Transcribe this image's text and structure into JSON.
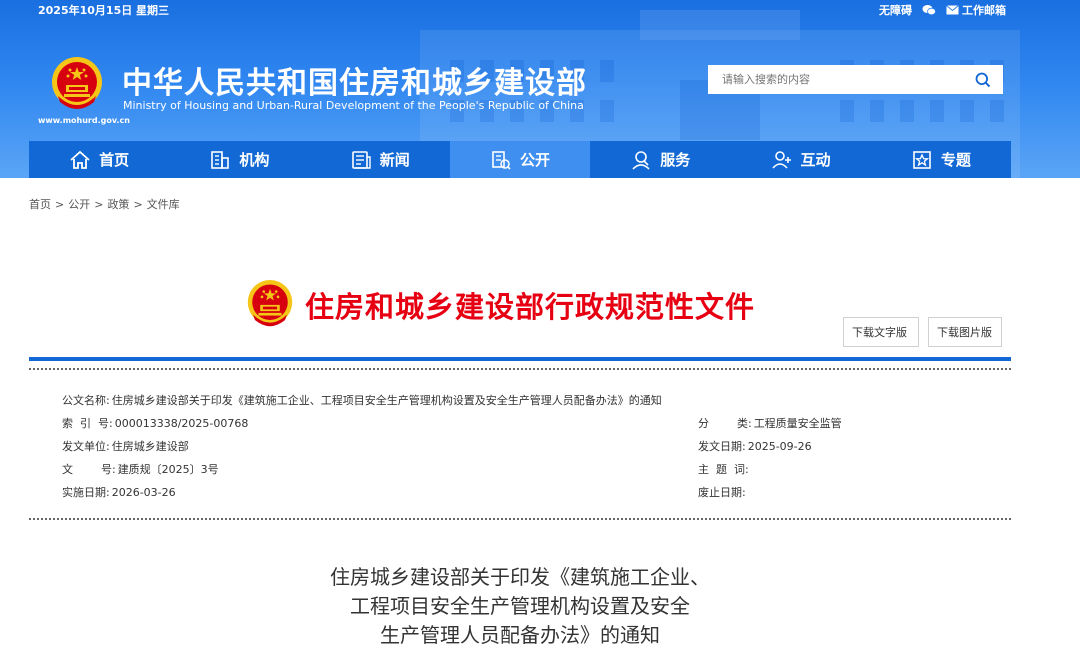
{
  "topbar": {
    "date": "2025年10月15日 星期三",
    "accessibility": "无障碍",
    "mail": "工作邮箱"
  },
  "site": {
    "url": "www.mohurd.gov.cn",
    "title": "中华人民共和国住房和城乡建设部",
    "subtitle": "Ministry of Housing and Urban-Rural Development of the People's Republic of China"
  },
  "search": {
    "placeholder": "请输入搜索的内容"
  },
  "nav": {
    "items": [
      {
        "label": "首页",
        "icon": "home-icon"
      },
      {
        "label": "机构",
        "icon": "building-icon"
      },
      {
        "label": "新闻",
        "icon": "news-icon"
      },
      {
        "label": "公开",
        "icon": "public-icon",
        "active": true
      },
      {
        "label": "服务",
        "icon": "service-icon"
      },
      {
        "label": "互动",
        "icon": "interact-icon"
      },
      {
        "label": "专题",
        "icon": "topic-icon"
      }
    ]
  },
  "breadcrumb": [
    "首页",
    "公开",
    "政策",
    "文件库"
  ],
  "doc_banner": {
    "title": "住房和城乡建设部行政规范性文件",
    "download_text": "下载文字版",
    "download_image": "下载图片版"
  },
  "meta": {
    "doc_name_label": "公文名称:",
    "doc_name": "住房城乡建设部关于印发《建筑施工企业、工程项目安全生产管理机构设置及安全生产管理人员配备办法》的通知",
    "index_label": "索  引  号:",
    "index": "000013338/2025-00768",
    "category_label": "分        类:",
    "category": "工程质量安全监管",
    "issuer_label": "发文单位:",
    "issuer": "住房城乡建设部",
    "issue_date_label": "发文日期:",
    "issue_date": "2025-09-26",
    "doc_no_label": "文        号:",
    "doc_no": "建质规〔2025〕3号",
    "subject_label": "主  题  词:",
    "subject": "",
    "effective_label": "实施日期:",
    "effective": "2026-03-26",
    "expiry_label": "废止日期:",
    "expiry": ""
  },
  "doc_title": {
    "line1": "住房城乡建设部关于印发《建筑施工企业、",
    "line2": "工程项目安全生产管理机构设置及安全",
    "line3": "生产管理人员配备办法》的通知"
  },
  "colors": {
    "header_blue": "#1a6fe0",
    "nav_blue": "#1268d4",
    "nav_active": "#3f8ff0",
    "banner_red": "#e60012"
  }
}
